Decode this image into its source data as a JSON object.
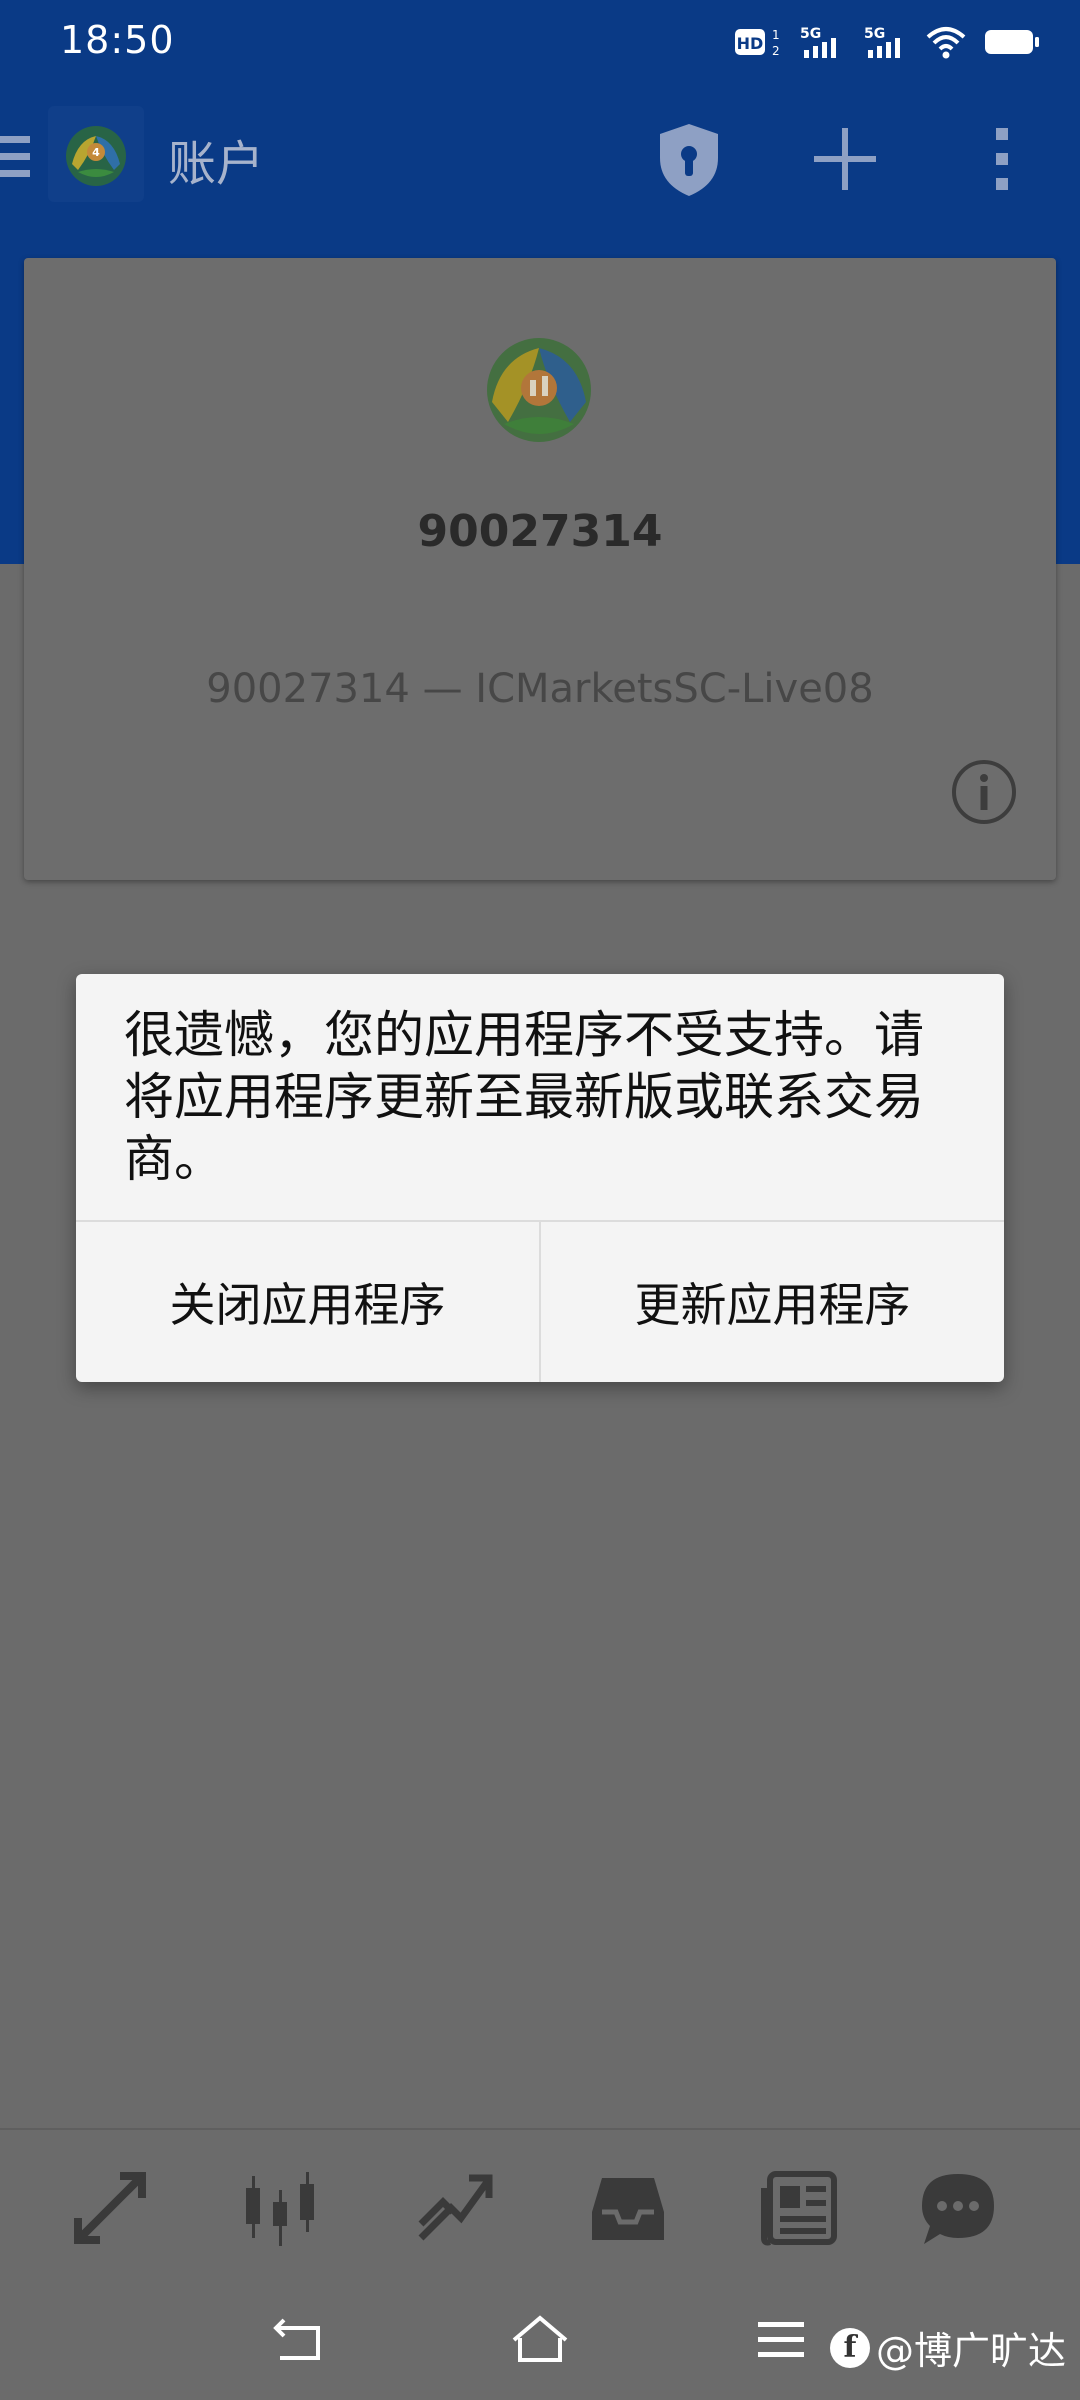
{
  "status_bar": {
    "time": "18:50",
    "indicators": [
      "hd-icon",
      "signal-5g-icon",
      "signal-5g-icon",
      "wifi-icon",
      "battery-icon"
    ]
  },
  "app_bar": {
    "title": "账户",
    "actions": [
      "shield-key-icon",
      "plus-icon",
      "more-vert-icon"
    ]
  },
  "account_card": {
    "account_number": "90027314",
    "server_line": "90027314 — ICMarketsSC-Live08"
  },
  "dialog": {
    "message": "很遗憾，您的应用程序不受支持。请将应用程序更新至最新版或联系交易商。",
    "close_label": "关闭应用程序",
    "update_label": "更新应用程序"
  },
  "bottom_nav": {
    "items": [
      "quotes-arrows-icon",
      "chart-candles-icon",
      "trade-trend-icon",
      "history-inbox-icon",
      "news-icon",
      "chat-icon"
    ]
  },
  "watermark": {
    "text": "@博广旷达"
  },
  "colors": {
    "brand_blue": "#0a3a86",
    "overlay_gray": "#6b6b6b",
    "dialog_bg": "#f4f4f4"
  }
}
